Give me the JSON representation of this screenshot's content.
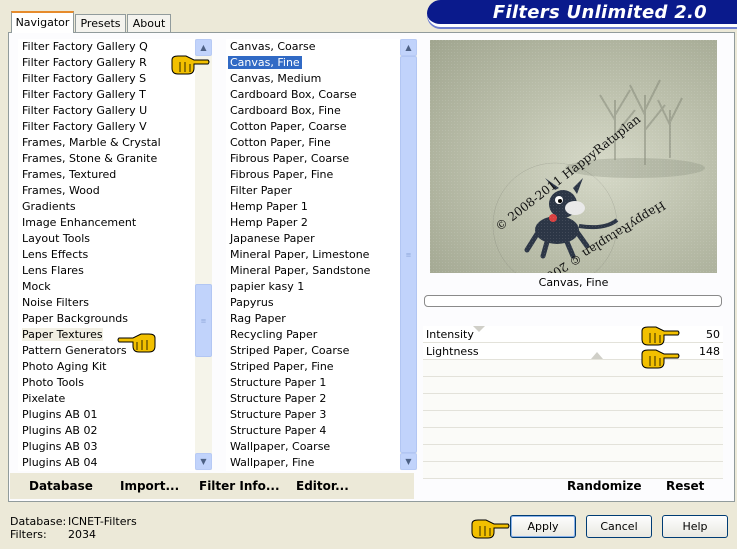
{
  "window": {
    "title": "Filters Unlimited 2.0"
  },
  "tabs": [
    "Navigator",
    "Presets",
    "About"
  ],
  "categories": [
    "Filter Factory Gallery Q",
    "Filter Factory Gallery R",
    "Filter Factory Gallery S",
    "Filter Factory Gallery T",
    "Filter Factory Gallery U",
    "Filter Factory Gallery V",
    "Frames, Marble & Crystal",
    "Frames, Stone & Granite",
    "Frames, Textured",
    "Frames, Wood",
    "Gradients",
    "Image Enhancement",
    "Layout Tools",
    "Lens Effects",
    "Lens Flares",
    "Mock",
    "Noise Filters",
    "Paper Backgrounds",
    "Paper Textures",
    "Pattern Generators",
    "Photo Aging Kit",
    "Photo Tools",
    "Pixelate",
    "Plugins AB 01",
    "Plugins AB 02",
    "Plugins AB 03",
    "Plugins AB 04"
  ],
  "selected_category": "Paper Textures",
  "filters": [
    "Canvas, Coarse",
    "Canvas, Fine",
    "Canvas, Medium",
    "Cardboard Box, Coarse",
    "Cardboard Box, Fine",
    "Cotton Paper, Coarse",
    "Cotton Paper, Fine",
    "Fibrous Paper, Coarse",
    "Fibrous Paper, Fine",
    "Filter Paper",
    "Hemp Paper 1",
    "Hemp Paper 2",
    "Japanese Paper",
    "Mineral Paper, Limestone",
    "Mineral Paper, Sandstone",
    "papier kasy 1",
    "Papyrus",
    "Rag Paper",
    "Recycling Paper",
    "Striped Paper, Coarse",
    "Striped Paper, Fine",
    "Structure Paper 1",
    "Structure Paper 2",
    "Structure Paper 3",
    "Structure Paper 4",
    "Wallpaper, Coarse",
    "Wallpaper, Fine"
  ],
  "selected_filter": "Canvas, Fine",
  "preview": {
    "caption": "Canvas, Fine",
    "watermark_top": "© 2008-2011  HappyRatuplan",
    "watermark_bottom": "HappyRatuplan © 2008-2011"
  },
  "sliders": [
    {
      "label": "Intensity",
      "value": "50",
      "level": 0.196
    },
    {
      "label": "Lightness",
      "value": "148",
      "level": 0.58
    }
  ],
  "toolbar": {
    "database": "Database",
    "import": "Import...",
    "filter_info": "Filter Info...",
    "editor": "Editor...",
    "randomize": "Randomize",
    "reset": "Reset"
  },
  "footer": {
    "database_label": "Database:",
    "database_value": "ICNET-Filters",
    "filters_label": "Filters:",
    "filters_value": "2034"
  },
  "buttons": {
    "apply": "Apply",
    "cancel": "Cancel",
    "help": "Help"
  },
  "colors": {
    "banner": "#0a1a8c",
    "selection": "#316ac5",
    "hand": "#f2c000"
  },
  "icons": [
    "pointing-hand-icon",
    "scroll-up-icon",
    "scroll-down-icon"
  ]
}
